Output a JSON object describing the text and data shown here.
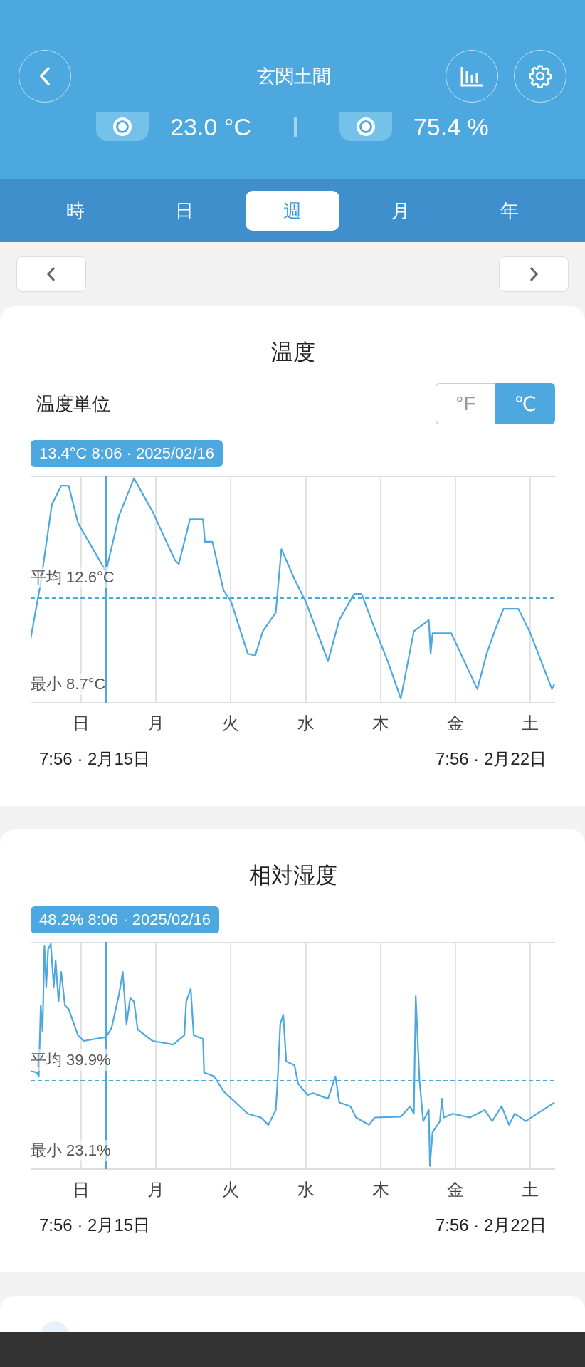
{
  "header": {
    "title": "玄関土間",
    "readings": [
      {
        "value": "23.0 °C"
      },
      {
        "value": "75.4 %"
      }
    ]
  },
  "tabs": [
    {
      "label": "時",
      "selected": false
    },
    {
      "label": "日",
      "selected": false
    },
    {
      "label": "週",
      "selected": true
    },
    {
      "label": "月",
      "selected": false
    },
    {
      "label": "年",
      "selected": false
    }
  ],
  "cards": [
    {
      "kind": "temperature",
      "title": "温度",
      "unit_label": "温度単位",
      "units": [
        {
          "label": "°F",
          "selected": false
        },
        {
          "label": "℃",
          "selected": true
        }
      ],
      "tooltip": "13.4°C 8:06 · 2025/02/16",
      "average": "平均 12.6°C",
      "minimum": "最小 8.7°C",
      "days": [
        "日",
        "月",
        "火",
        "水",
        "木",
        "金",
        "土"
      ],
      "start": "7:56 · 2月15日",
      "end": "7:56 · 2月22日"
    },
    {
      "kind": "humidity",
      "title": "相対湿度",
      "tooltip": "48.2% 8:06 · 2025/02/16",
      "average": "平均 39.9%",
      "minimum": "最小 23.1%",
      "days": [
        "日",
        "月",
        "火",
        "水",
        "木",
        "金",
        "土"
      ],
      "start": "7:56 · 2月15日",
      "end": "7:56 · 2月22日"
    }
  ]
}
